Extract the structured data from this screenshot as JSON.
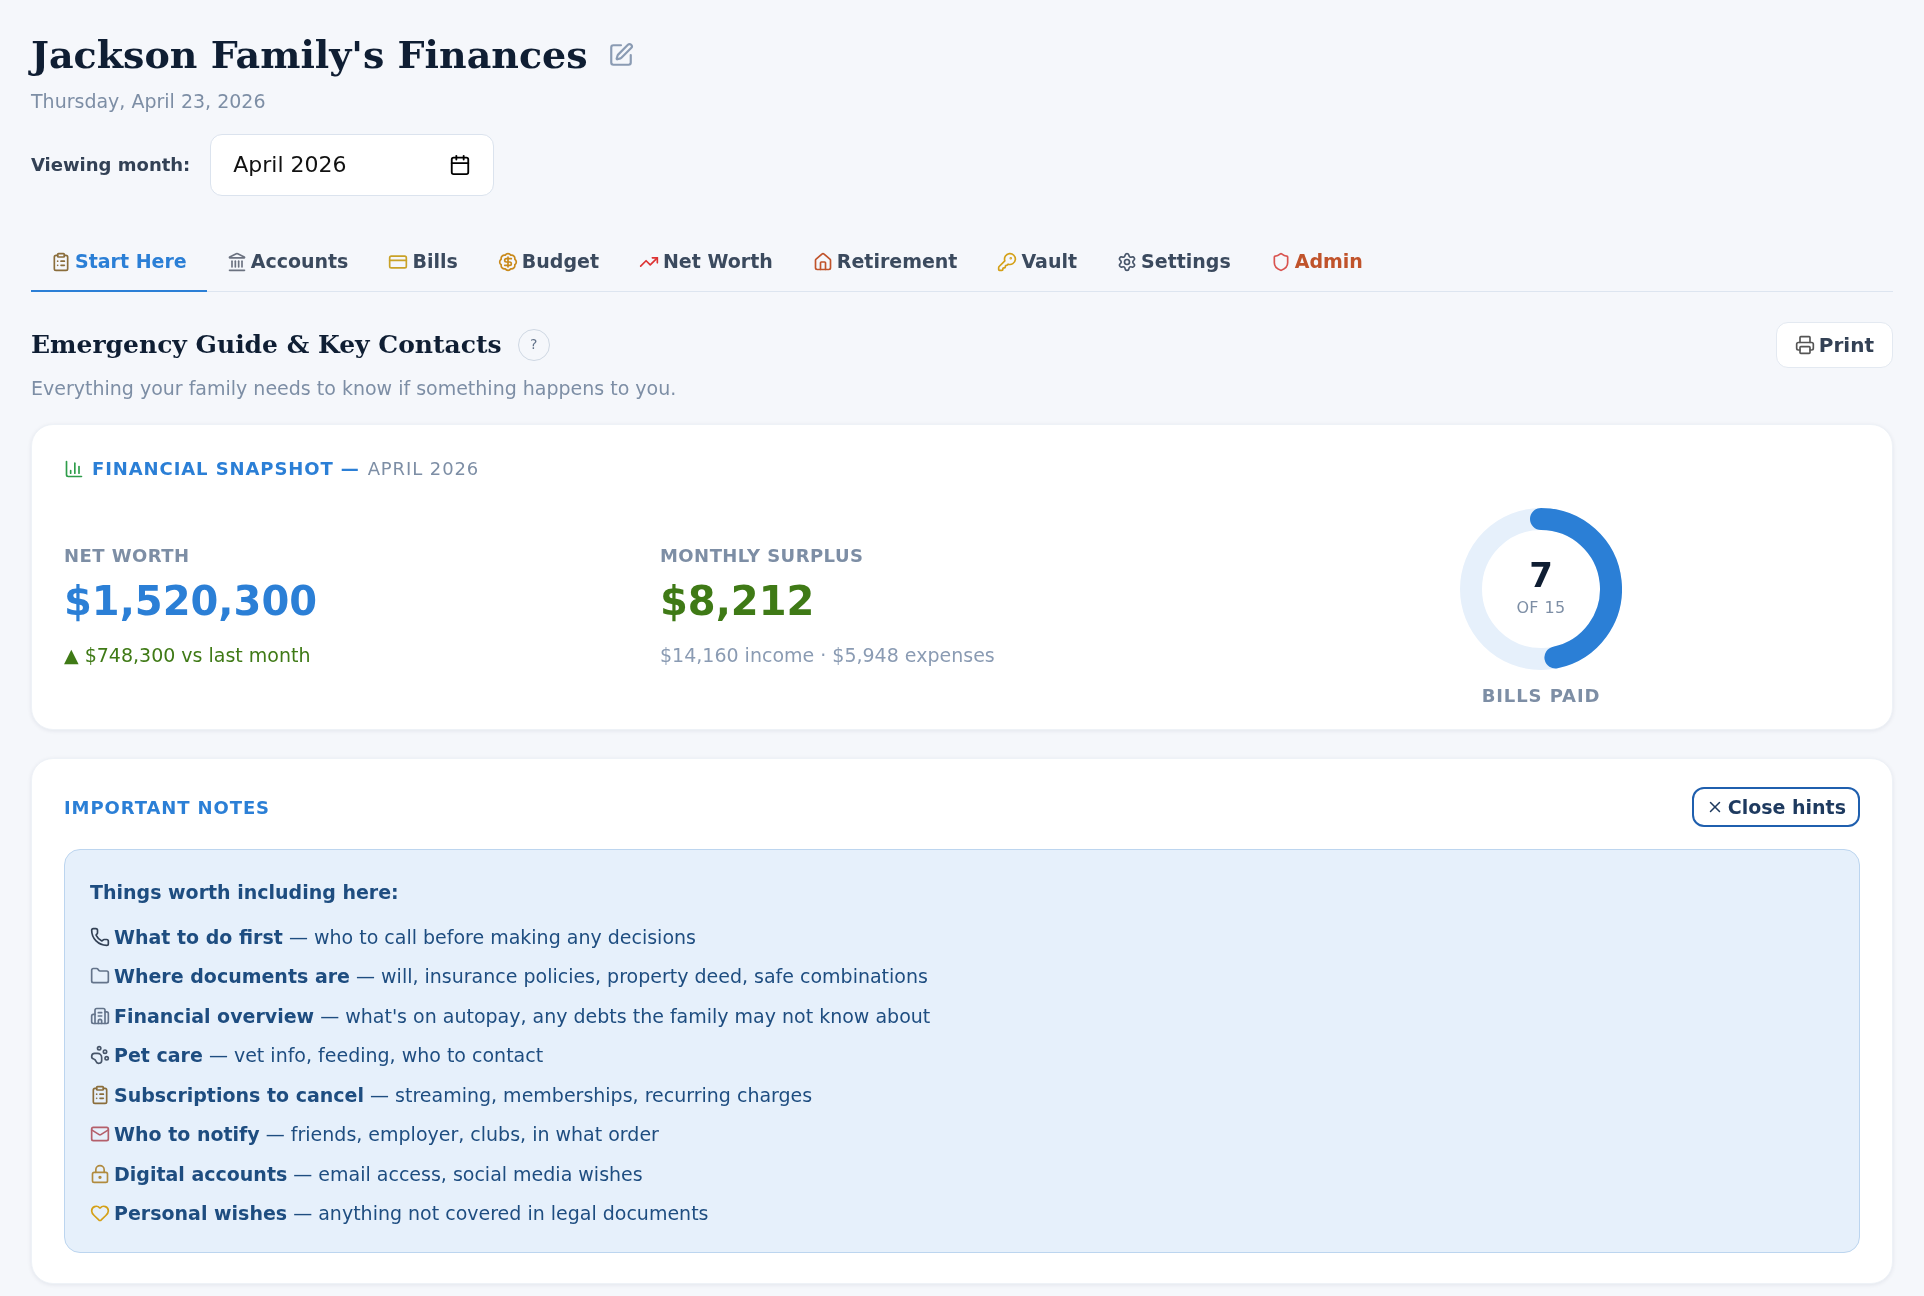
{
  "header": {
    "title": "Jackson Family's Finances",
    "date": "Thursday, April 23, 2026"
  },
  "month_picker": {
    "label": "Viewing month:",
    "value": "April 2026"
  },
  "tabs": [
    {
      "label": "Start Here",
      "selected": true,
      "kind": "normal"
    },
    {
      "label": "Accounts",
      "selected": false,
      "kind": "normal"
    },
    {
      "label": "Bills",
      "selected": false,
      "kind": "normal"
    },
    {
      "label": "Budget",
      "selected": false,
      "kind": "normal"
    },
    {
      "label": "Net Worth",
      "selected": false,
      "kind": "normal"
    },
    {
      "label": "Retirement",
      "selected": false,
      "kind": "normal"
    },
    {
      "label": "Vault",
      "selected": false,
      "kind": "normal"
    },
    {
      "label": "Settings",
      "selected": false,
      "kind": "normal"
    },
    {
      "label": "Admin",
      "selected": false,
      "kind": "admin"
    }
  ],
  "section": {
    "title": "Emergency Guide & Key Contacts",
    "help": "?",
    "subtitle": "Everything your family needs to know if something happens to you.",
    "print_button": "Print"
  },
  "snapshot": {
    "title": "FINANCIAL SNAPSHOT —",
    "period": "APRIL 2026",
    "net_worth": {
      "label": "NET WORTH",
      "value": "$1,520,300",
      "change": "▲ $748,300 vs last month"
    },
    "surplus": {
      "label": "MONTHLY SURPLUS",
      "value": "$8,212",
      "detail": "$14,160 income · $5,948 expenses"
    },
    "bills_paid": {
      "count": "7",
      "total": "OF 15",
      "label": "BILLS PAID",
      "level": 0.467
    }
  },
  "notes": {
    "title": "IMPORTANT NOTES",
    "close_button": "Close hints",
    "hint_heading": "Things worth including here:",
    "items": [
      {
        "text": "**What to do first** — who to call before making any decisions"
      },
      {
        "text": "**Where documents are** — will, insurance policies, property deed, safe combinations"
      },
      {
        "text": "**Financial overview** — what's on autopay, any debts the family may not know about"
      },
      {
        "text": "**Pet care** — vet info, feeding, who to contact"
      },
      {
        "text": "**Subscriptions to cancel** — streaming, memberships, recurring charges"
      },
      {
        "text": "**Who to notify** — friends, employer, clubs, in what order"
      },
      {
        "text": "**Digital accounts** — email access, social media wishes"
      },
      {
        "text": "**Personal wishes** — anything not covered in legal documents"
      }
    ]
  }
}
